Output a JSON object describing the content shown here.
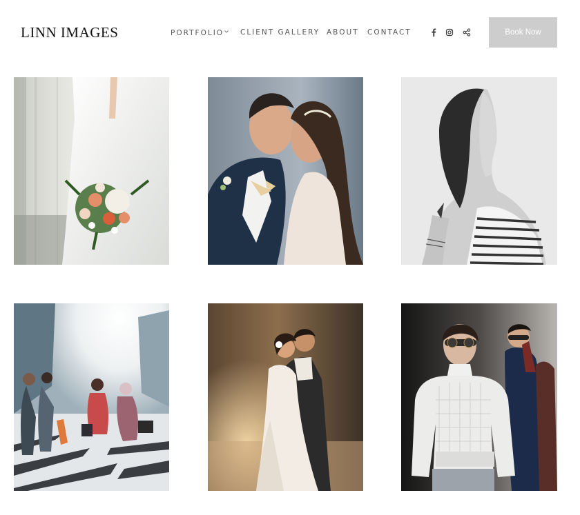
{
  "header": {
    "logo_text": "LINN IMAGES",
    "nav": {
      "portfolio": "PORTFOLIO",
      "client_gallery": "CLIENT GALLERY",
      "about": "ABOUT",
      "contact": "CONTACT"
    },
    "social_icons": [
      "facebook-icon",
      "instagram-icon",
      "share-icon"
    ],
    "book_button": "Book Now"
  },
  "gallery": {
    "photos": [
      {
        "subject": "bridal-bouquet",
        "tone": "color"
      },
      {
        "subject": "couple-kiss",
        "tone": "color"
      },
      {
        "subject": "woman-profile",
        "tone": "black-and-white"
      },
      {
        "subject": "city-street-crosswalk",
        "tone": "color"
      },
      {
        "subject": "couple-sunset-embrace",
        "tone": "color"
      },
      {
        "subject": "fashion-runway-model",
        "tone": "color"
      }
    ]
  },
  "colors": {
    "button_bg": "#cdcdcd",
    "nav_text": "#555555",
    "logo_text": "#111111"
  }
}
